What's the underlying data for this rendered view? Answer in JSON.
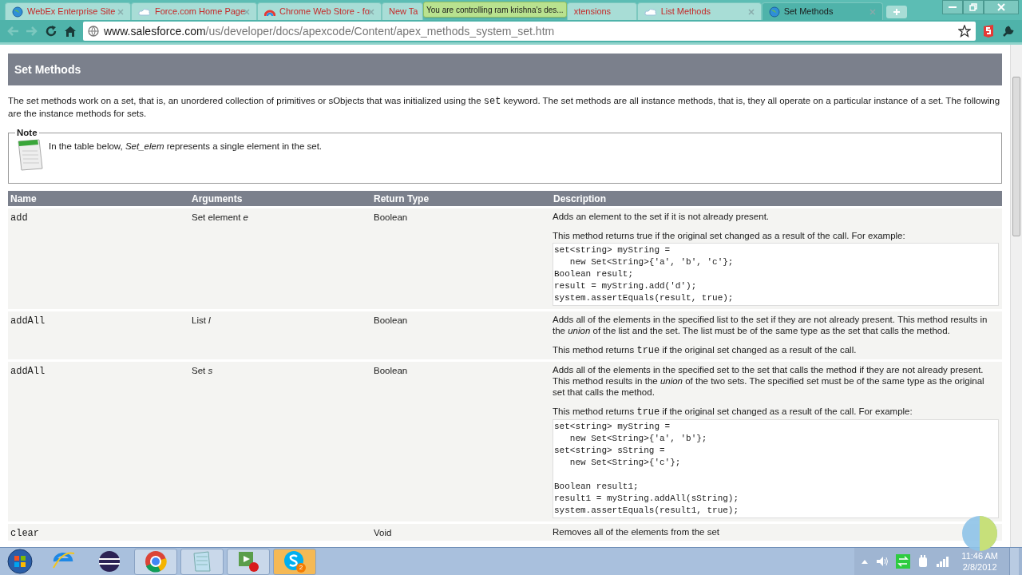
{
  "tabs": [
    {
      "label": "WebEx Enterprise Site",
      "selected": false
    },
    {
      "label": "Force.com Home Page",
      "selected": false
    },
    {
      "label": "Chrome Web Store - fo",
      "selected": false
    },
    {
      "label": "New Ta",
      "selected": false
    },
    {
      "label": "xtensions",
      "selected": false
    },
    {
      "label": "List Methods",
      "selected": false
    },
    {
      "label": "Set Methods",
      "selected": true
    }
  ],
  "notification": {
    "text": "You are controlling ram krishna's des..."
  },
  "address_bar": {
    "domain": "www.salesforce.com",
    "path": "/us/developer/docs/apexcode/Content/apex_methods_system_set.htm"
  },
  "page": {
    "title": "Set Methods",
    "intro": [
      {
        "text": "The set methods work on a set, that is, an unordered collection of primitives or sObjects that was initialized using the ",
        "kind": "plain"
      },
      {
        "text": "set",
        "kind": "code"
      },
      {
        "text": " keyword. The set methods are all instance methods, that is, they all operate on a particular instance of a set. The following are the instance methods for sets.",
        "kind": "plain"
      }
    ],
    "note": {
      "legend": "Note",
      "text": "In the table below, *Set_elem* represents a single element in the set."
    },
    "table": {
      "columns": [
        "Name",
        "Arguments",
        "Return Type",
        "Description"
      ],
      "rows": [
        {
          "name": "add",
          "arguments": "Set element *e*",
          "return_type": "Boolean",
          "description": [
            {
              "kind": "text",
              "segments": [
                {
                  "text": "Adds an element to the set if it is not already present.",
                  "kind": "plain"
                }
              ]
            },
            {
              "kind": "text",
              "segments": [
                {
                  "text": "This method returns true if the original set changed as a result of the call. For example:",
                  "kind": "plain"
                }
              ]
            },
            {
              "kind": "code",
              "text": "set<string> myString = \n   new Set<String>{'a', 'b', 'c'};\nBoolean result;\nresult = myString.add('d');\nsystem.assertEquals(result, true);"
            }
          ]
        },
        {
          "name": "addAll",
          "arguments": "List *l*",
          "return_type": "Boolean",
          "description": [
            {
              "kind": "text",
              "segments": [
                {
                  "text": "Adds all of the elements in the specified list to the set if they are not already present. This method results in the *union* of the list and the set. The list must be of the same type as the set that calls the method.",
                  "kind": "plain"
                }
              ]
            },
            {
              "kind": "text",
              "segments": [
                {
                  "text": "This method returns ",
                  "kind": "plain"
                },
                {
                  "text": "true",
                  "kind": "code"
                },
                {
                  "text": " if the original set changed as a result of the call.",
                  "kind": "plain"
                }
              ]
            }
          ]
        },
        {
          "name": "addAll",
          "arguments": "Set *s*",
          "return_type": "Boolean",
          "description": [
            {
              "kind": "text",
              "segments": [
                {
                  "text": "Adds all of the elements in the specified set to the set that calls the method if they are not already present. This method results in the *union* of the two sets. The specified set must be of the same type as the original set that calls the method.",
                  "kind": "plain"
                }
              ]
            },
            {
              "kind": "text",
              "segments": [
                {
                  "text": "This method returns ",
                  "kind": "plain"
                },
                {
                  "text": "true",
                  "kind": "code"
                },
                {
                  "text": " if the original set changed as a result of the call. For example:",
                  "kind": "plain"
                }
              ]
            },
            {
              "kind": "code",
              "text": "set<string> myString = \n   new Set<String>{'a', 'b'};\nset<string> sString = \n   new Set<String>{'c'};\n\nBoolean result1;\nresult1 = myString.addAll(sString);\nsystem.assertEquals(result1, true);"
            }
          ]
        },
        {
          "name": "clear",
          "arguments": "",
          "return_type": "Void",
          "description": [
            {
              "kind": "text",
              "segments": [
                {
                  "text": "Removes all of the elements from the set",
                  "kind": "plain"
                }
              ]
            }
          ]
        }
      ]
    }
  },
  "taskbar": {
    "apps": [
      {
        "kind": "ie",
        "active": false
      },
      {
        "kind": "eclipse",
        "active": false
      },
      {
        "kind": "chrome",
        "active": true
      },
      {
        "kind": "notepad",
        "active": true
      },
      {
        "kind": "recorder",
        "active": true
      },
      {
        "kind": "skype",
        "active": true,
        "badge": "2",
        "highlighted": true
      }
    ],
    "time": "11:46 AM",
    "date": "2/8/2012"
  }
}
